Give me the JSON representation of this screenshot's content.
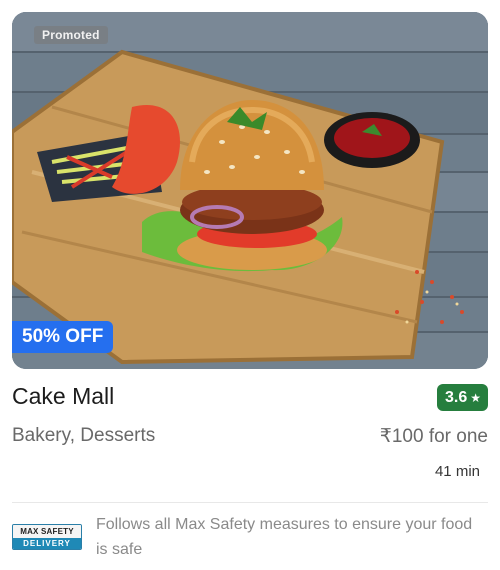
{
  "card": {
    "promoted_label": "Promoted",
    "offer_label": "50% OFF",
    "title": "Cake Mall",
    "rating": "3.6",
    "rating_icon": "star-icon",
    "cuisines": "Bakery, Desserts",
    "price": "₹100 for one",
    "delivery_time": "41 min",
    "image_icon": "burger-photo"
  },
  "safety": {
    "badge_top": "MAX SAFETY",
    "badge_bottom": "DELIVERY",
    "text": "Follows all Max Safety measures to ensure your food is safe"
  },
  "colors": {
    "offer_bg": "#256fef",
    "rating_bg": "#267e3e",
    "badge_blue": "#1f89b6"
  }
}
